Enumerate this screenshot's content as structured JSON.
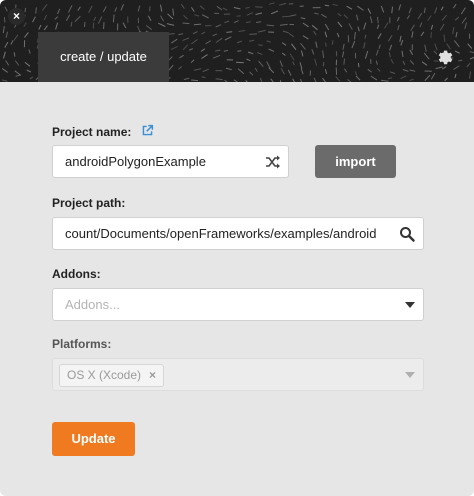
{
  "window": {
    "close_glyph": "×",
    "close_icon": "close-icon",
    "tab_label": "create / update",
    "settings_icon": "gear-icon"
  },
  "form": {
    "project_name": {
      "label": "Project name:",
      "value": "androidPolygonExample",
      "link_icon": "external-link-icon",
      "shuffle_icon": "shuffle-icon"
    },
    "import_label": "import",
    "project_path": {
      "label": "Project path:",
      "value": "count/Documents/openFrameworks/examples/android",
      "search_icon": "search-icon"
    },
    "addons": {
      "label": "Addons:",
      "placeholder": "Addons...",
      "dropdown_icon": "caret-down-icon"
    },
    "platforms": {
      "label": "Platforms:",
      "selected": "OS X (Xcode)",
      "remove_glyph": "×",
      "dropdown_icon": "caret-down-icon"
    },
    "update_label": "Update"
  },
  "colors": {
    "header_bg": "#1f1f1f",
    "tab_bg": "#3b3b3b",
    "panel_bg": "#e6e6e6",
    "import_bg": "#6b6b6b",
    "update_bg": "#f07a1f",
    "link_blue": "#3a8fd8"
  }
}
